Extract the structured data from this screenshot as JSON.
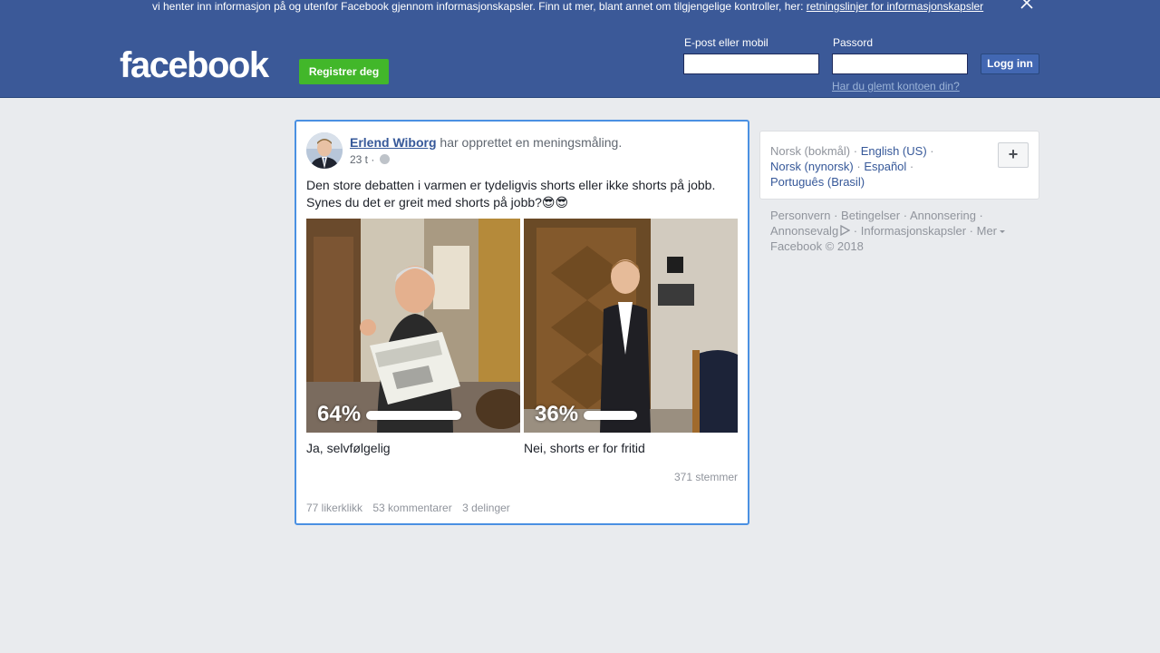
{
  "cookie_banner": {
    "text": "vi henter inn informasjon på og utenfor Facebook gjennom informasjonskapsler. Finn ut mer, blant annet om tilgjengelige kontroller, her: ",
    "link": "retningslinjer for informasjonskapsler",
    "close_icon": "close-icon"
  },
  "header": {
    "logo": "facebook",
    "register_label": "Registrer deg",
    "email_label": "E-post eller mobil",
    "email_value": "",
    "password_label": "Passord",
    "password_value": "",
    "login_label": "Logg inn",
    "forgot_link": "Har du glemt kontoen din?"
  },
  "post": {
    "author": "Erlend Wiborg",
    "action": " har opprettet en meningsmåling.",
    "time": "23 t · ",
    "privacy_icon": "globe-icon",
    "text_line1": "Den store debatten i varmen er tydeligvis shorts eller ikke shorts på jobb.",
    "text_line2": "Synes du det er greit med shorts på jobb?😎😎",
    "options": [
      {
        "label": "Ja, selvfølgelig",
        "percent_label": "64%",
        "share": 0.64
      },
      {
        "label": "Nei, shorts er for fritid",
        "percent_label": "36%",
        "share": 0.36
      }
    ],
    "votes": "371 stemmer",
    "likes": "77 likerklikk",
    "comments": "53 kommentarer",
    "shares": "3 delinger"
  },
  "languages": {
    "current": "Norsk (bokmål)",
    "items": [
      "English (US)",
      "Norsk (nynorsk)",
      "Español",
      "Português (Brasil)"
    ],
    "add_icon": "plus-icon"
  },
  "footer": {
    "links": [
      "Personvern",
      "Betingelser",
      "Annonsering",
      "Annonsevalg",
      "Informasjonskapsler",
      "Mer"
    ],
    "copyright": "Facebook © 2018"
  },
  "colors": {
    "brand": "#3b5998",
    "register": "#42b72a",
    "link": "#365899",
    "highlight": "#4a90e2"
  }
}
